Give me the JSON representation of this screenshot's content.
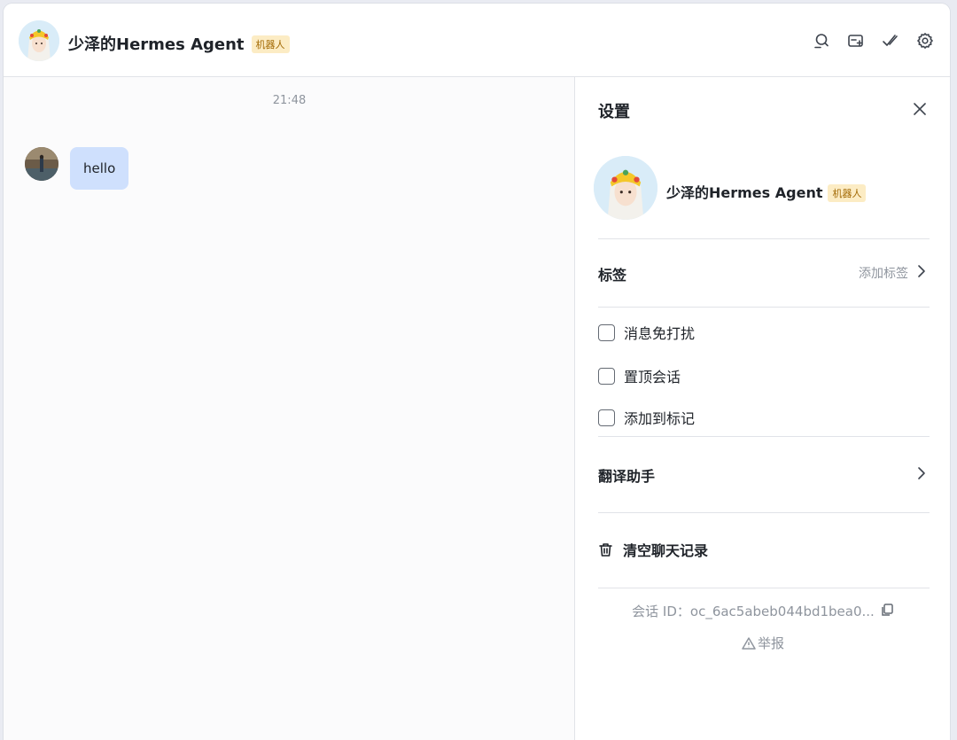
{
  "header": {
    "title": "少泽的Hermes Agent",
    "bot_tag": "机器人",
    "tools": [
      "search-icon",
      "add-group-icon",
      "checkmark-icon",
      "gear-icon"
    ]
  },
  "chat": {
    "time": "21:48",
    "messages": [
      {
        "text": "hello"
      }
    ]
  },
  "settings": {
    "title": "设置",
    "profile": {
      "name": "少泽的Hermes Agent",
      "bot_tag": "机器人"
    },
    "tags": {
      "label": "标签",
      "action": "添加标签"
    },
    "options": [
      {
        "label": "消息免打扰",
        "checked": false
      },
      {
        "label": "置顶会话",
        "checked": false
      },
      {
        "label": "添加到标记",
        "checked": false
      }
    ],
    "translate": {
      "label": "翻译助手"
    },
    "clear": {
      "label": "清空聊天记录"
    },
    "session_id": "会话 ID：oc_6ac5abeb044bd1bea0...",
    "report": "举报"
  }
}
